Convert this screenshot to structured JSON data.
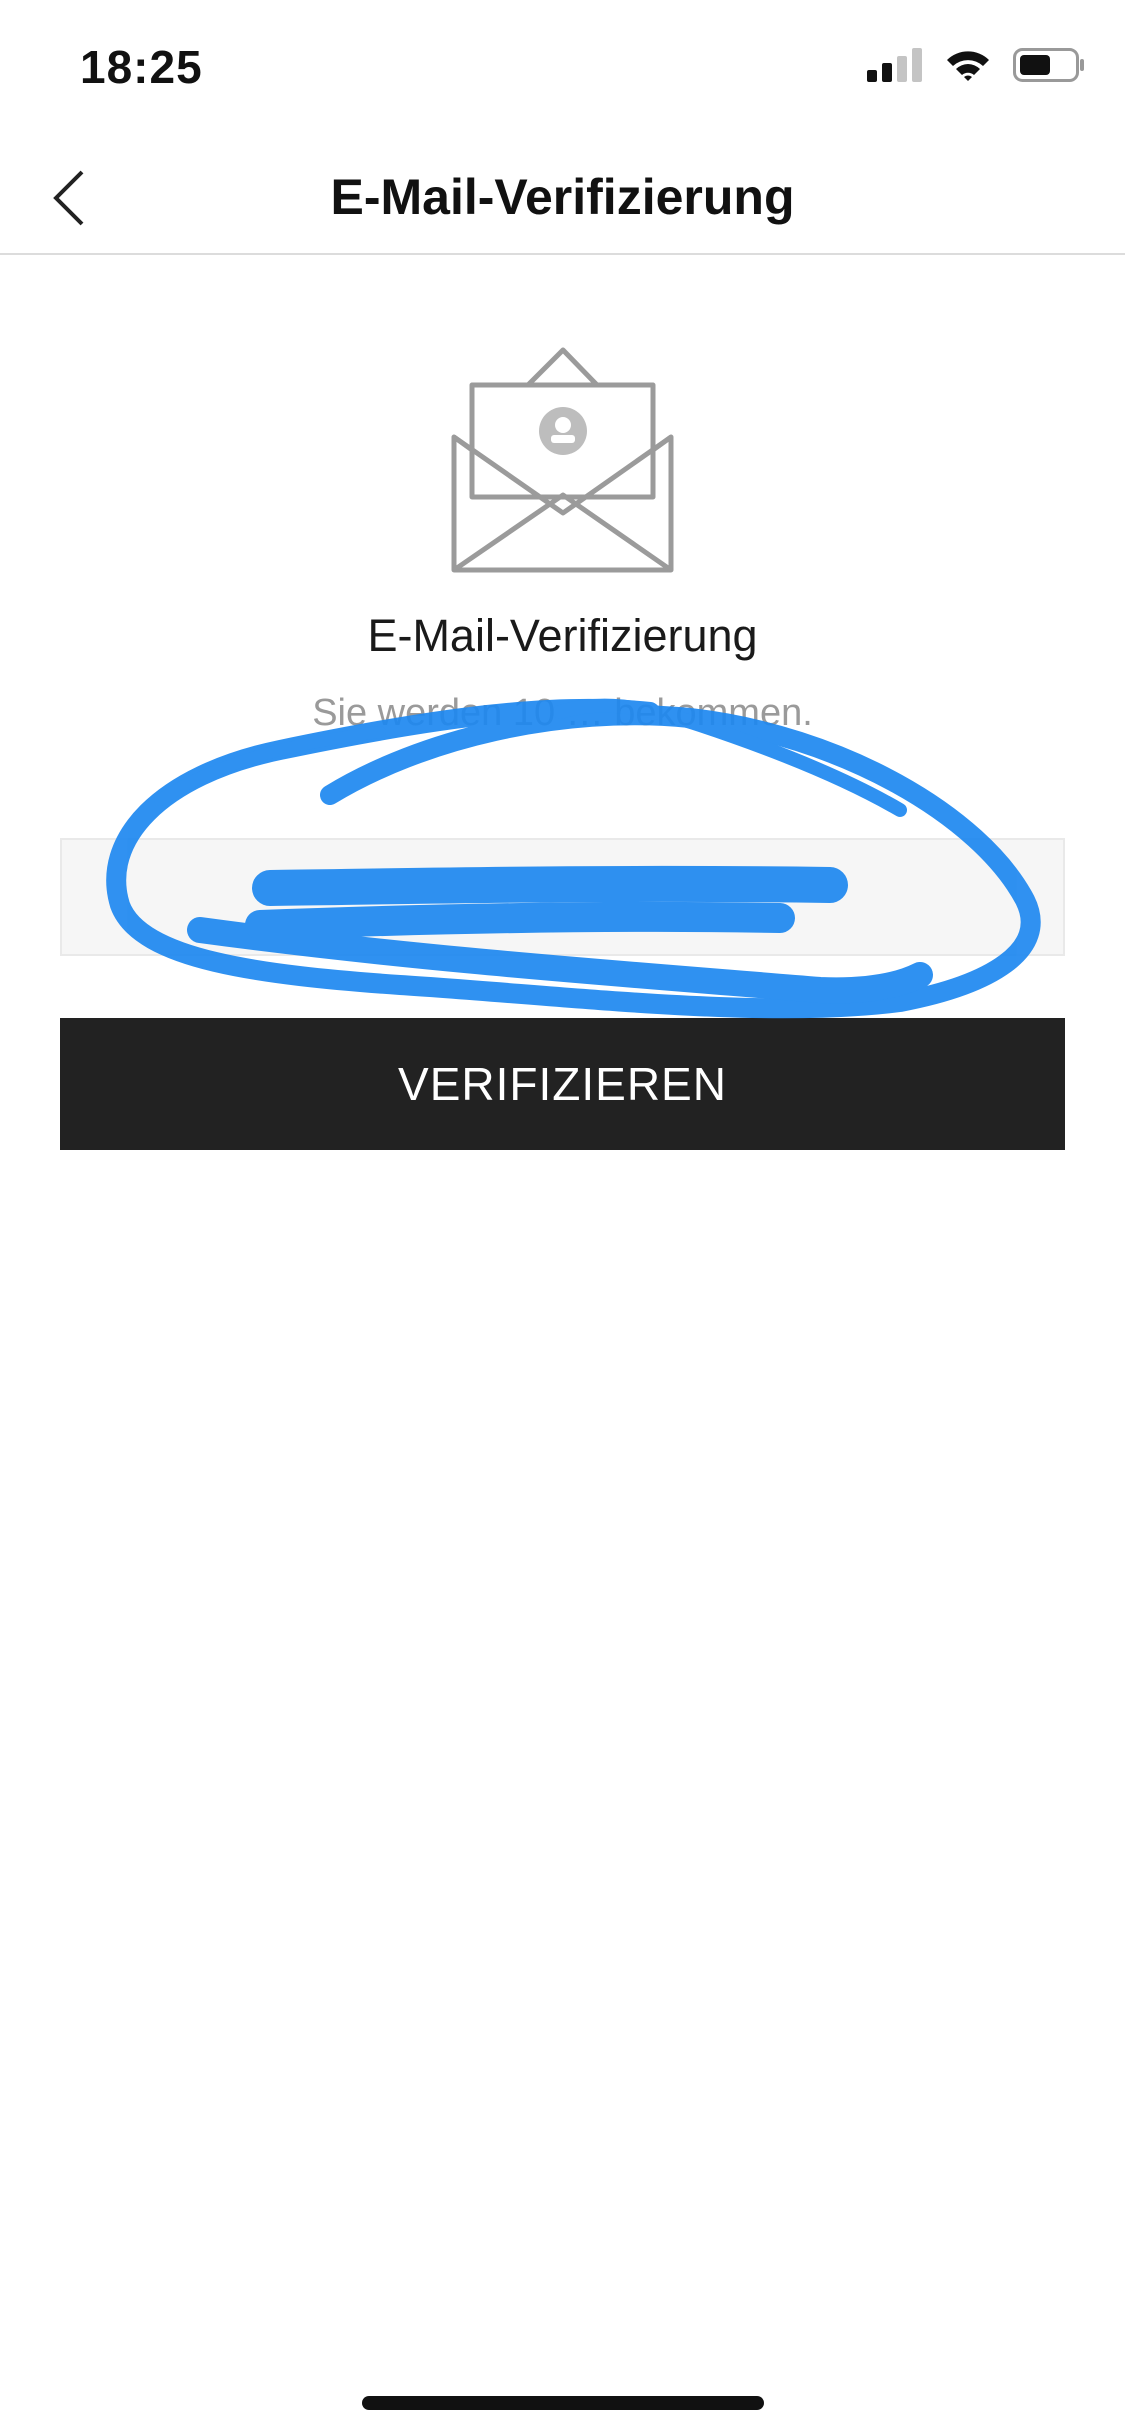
{
  "status_bar": {
    "time": "18:25",
    "icons": [
      "signal-icon",
      "wifi-icon",
      "battery-icon"
    ]
  },
  "nav": {
    "title": "E-Mail-Verifizierung",
    "back_icon": "chevron-left-icon"
  },
  "content": {
    "envelope_icon": "envelope-letter-icon",
    "headline": "E-Mail-Verifizierung",
    "subtext": "Sie werden 10 … bekommen.",
    "code_input": {
      "value": "",
      "placeholder": ""
    },
    "verify_label": "VERIFIZIEREN"
  },
  "annotation": {
    "type": "hand-drawn scribble (redaction)",
    "color": "#1e88f0"
  },
  "colors": {
    "button_bg": "#222222",
    "subtext": "#9a9a9a",
    "input_bg": "#f6f6f6"
  }
}
